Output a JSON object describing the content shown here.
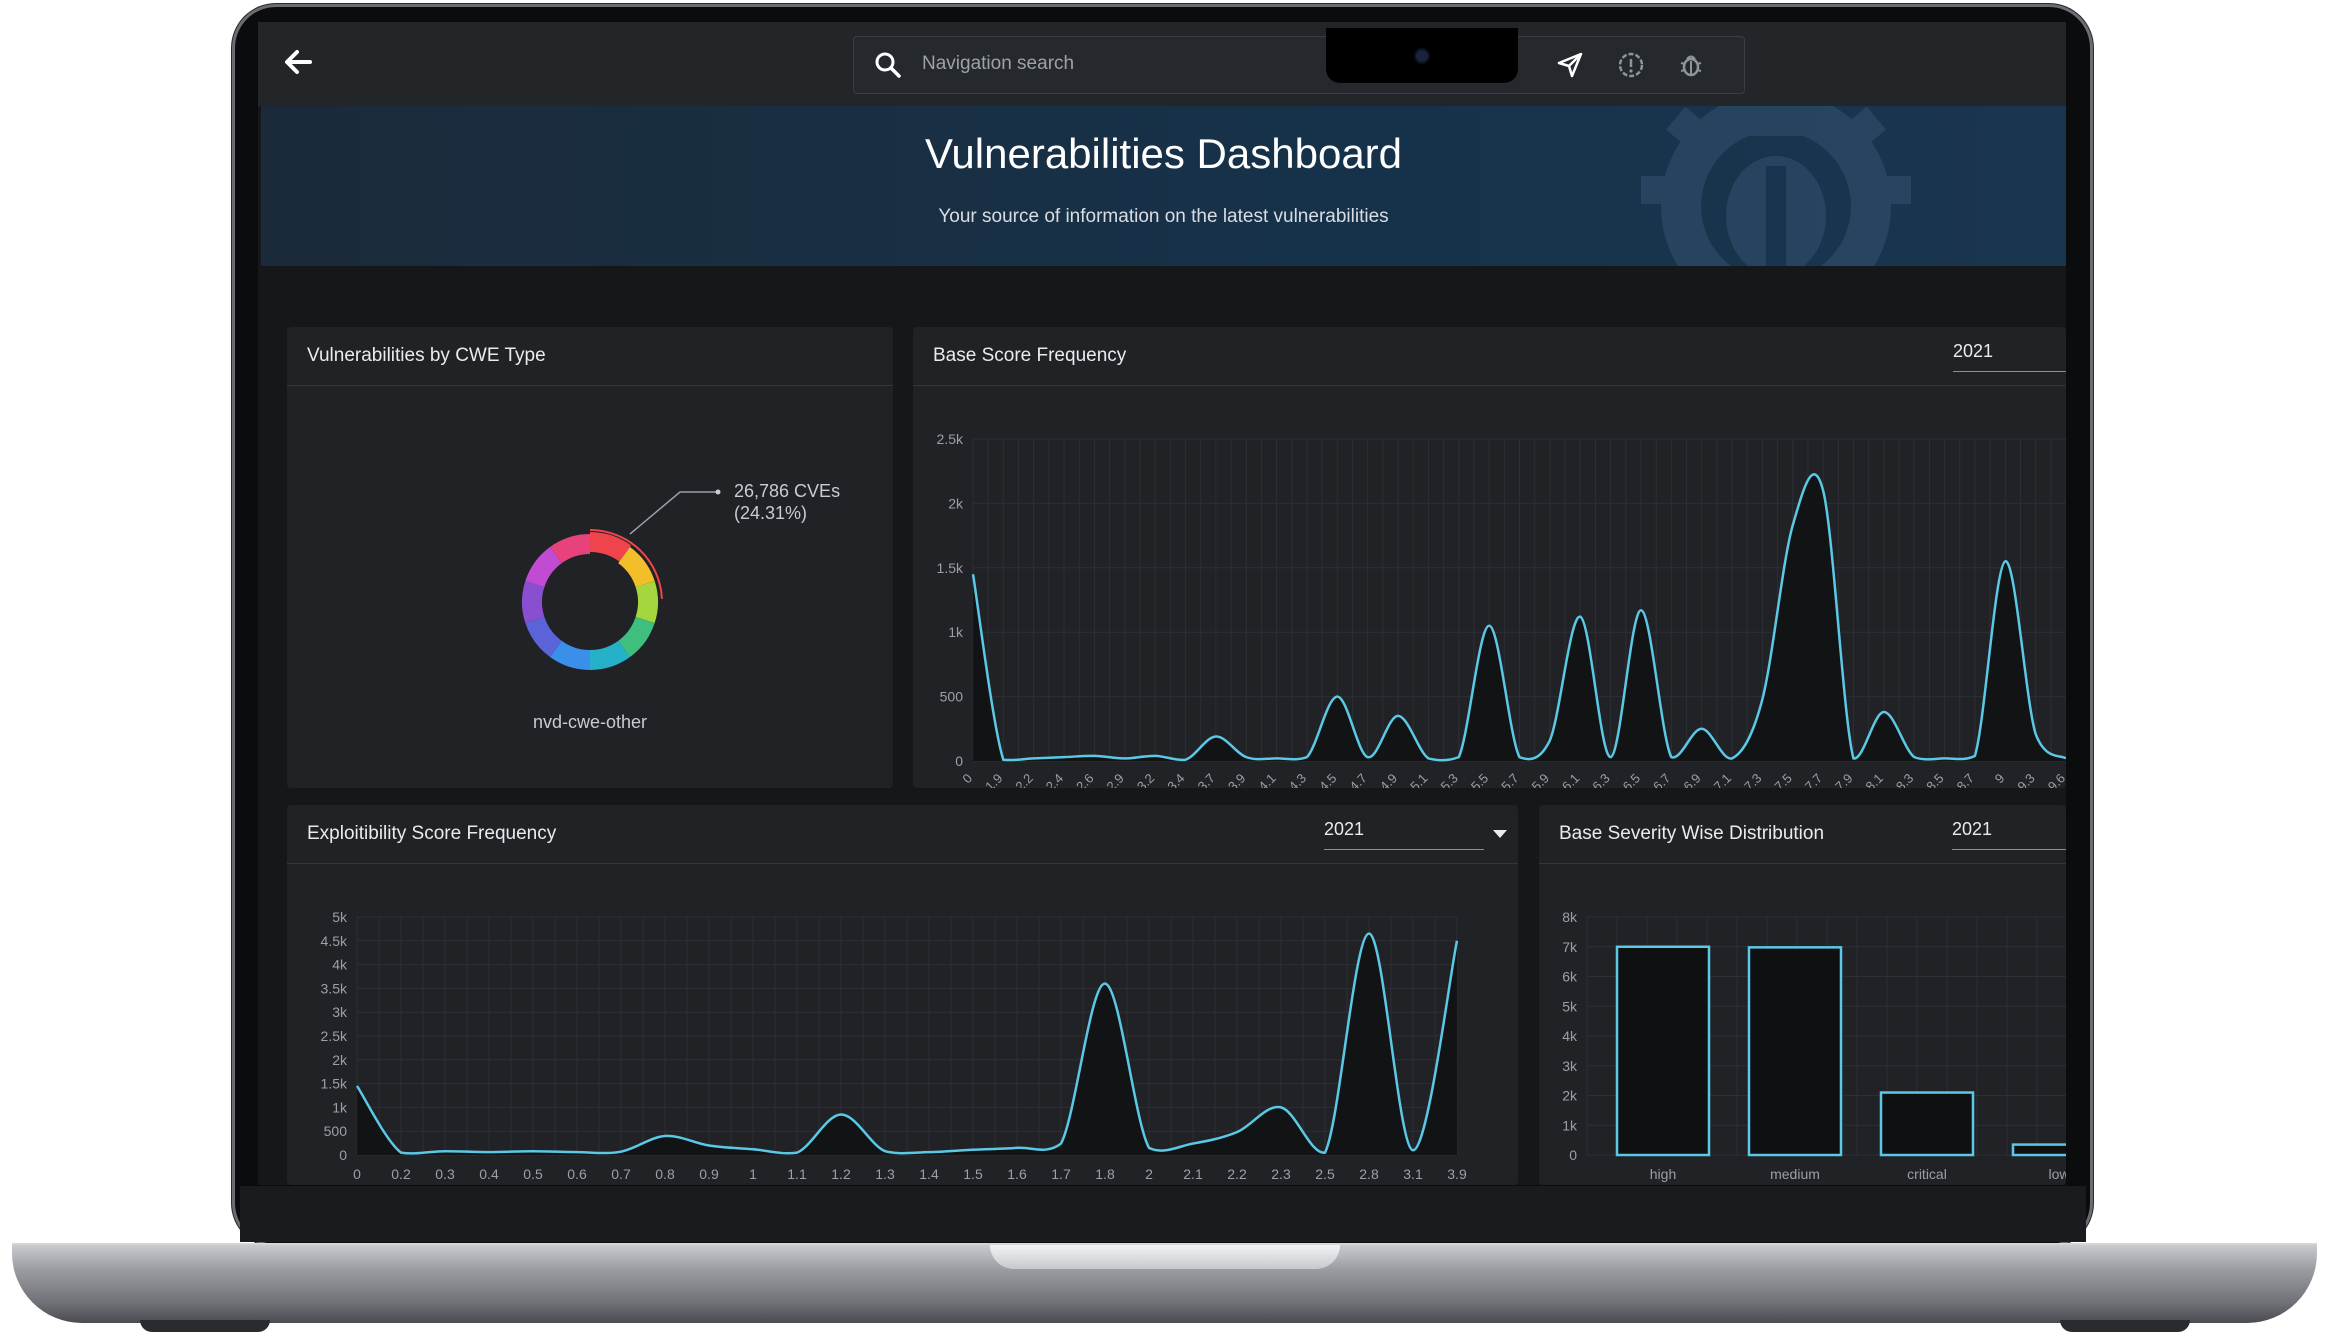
{
  "app": {
    "search_placeholder": "Navigation search",
    "title": "Vulnerabilities Dashboard",
    "subtitle": "Your source of information on the latest vulnerabilities"
  },
  "icons": [
    "back-arrow-icon",
    "search-icon",
    "send-icon",
    "alert-icon",
    "bug-icon",
    "gear-bug-watermark-icon",
    "dropdown-caret-icon"
  ],
  "colors": {
    "line": "#5bc8e6",
    "panel": "#202226",
    "hero": "#16324a",
    "text": "#e9ecef"
  },
  "panels": {
    "cwe": {
      "title": "Vulnerabilities by CWE Type",
      "tooltip_value": "26,786 CVEs",
      "tooltip_pct": "(24.31%)",
      "center_label": "nvd-cwe-other"
    },
    "base_score": {
      "title": "Base Score Frequency",
      "year": "2021"
    },
    "exploitability": {
      "title": "Exploitibility Score Frequency",
      "year": "2021"
    },
    "severity": {
      "title": "Base Severity Wise Distribution",
      "year": "2021"
    }
  },
  "chart_data": [
    {
      "type": "pie",
      "title": "Vulnerabilities by CWE Type",
      "labels": [
        "nvd-cwe-other"
      ],
      "highlight": {
        "label": "nvd-cwe-other",
        "value": 26786,
        "percent": 24.31
      },
      "colors": [
        "#f0444c",
        "#f2bf2a",
        "#a6d63d",
        "#3fbf7e",
        "#25b2c8",
        "#3a8fe8",
        "#5b63d8",
        "#8a4fd1",
        "#c24bd3",
        "#e8427c"
      ]
    },
    {
      "type": "line",
      "title": "Base Score Frequency",
      "x": [
        "0",
        "1.9",
        "2.2",
        "2.4",
        "2.6",
        "2.9",
        "3.2",
        "3.4",
        "3.7",
        "3.9",
        "4.1",
        "4.3",
        "4.5",
        "4.7",
        "4.9",
        "5.1",
        "5.3",
        "5.5",
        "5.7",
        "5.9",
        "6.1",
        "6.3",
        "6.5",
        "6.7",
        "6.9",
        "7.1",
        "7.3",
        "7.5",
        "7.7",
        "7.9",
        "8.1",
        "8.3",
        "8.5",
        "8.7",
        "9",
        "9.3",
        "9.6"
      ],
      "y": [
        1450,
        10,
        20,
        30,
        40,
        20,
        40,
        10,
        190,
        30,
        20,
        30,
        500,
        30,
        350,
        20,
        30,
        1050,
        30,
        160,
        1120,
        30,
        1170,
        30,
        250,
        20,
        480,
        1830,
        2100,
        20,
        380,
        30,
        20,
        40,
        1550,
        210,
        20
      ],
      "ylim": [
        0,
        2500
      ],
      "yticks": [
        "0",
        "500",
        "1k",
        "1.5k",
        "2k",
        "2.5k"
      ]
    },
    {
      "type": "line",
      "title": "Exploitibility Score Frequency",
      "x": [
        "0",
        "0.2",
        "0.3",
        "0.4",
        "0.5",
        "0.6",
        "0.7",
        "0.8",
        "0.9",
        "1",
        "1.1",
        "1.2",
        "1.3",
        "1.4",
        "1.5",
        "1.6",
        "1.7",
        "1.8",
        "2",
        "2.1",
        "2.2",
        "2.3",
        "2.5",
        "2.8",
        "3.1",
        "3.9"
      ],
      "y": [
        1450,
        50,
        80,
        60,
        80,
        60,
        70,
        400,
        200,
        120,
        50,
        850,
        80,
        60,
        110,
        150,
        240,
        3600,
        150,
        240,
        480,
        1000,
        50,
        4650,
        100,
        4500
      ],
      "ylim": [
        0,
        5000
      ],
      "yticks": [
        "0",
        "500",
        "1k",
        "1.5k",
        "2k",
        "2.5k",
        "3k",
        "3.5k",
        "4k",
        "4.5k",
        "5k"
      ]
    },
    {
      "type": "bar",
      "title": "Base Severity Wise Distribution",
      "categories": [
        "high",
        "medium",
        "critical",
        "low"
      ],
      "values": [
        7000,
        6980,
        2100,
        350
      ],
      "ylim": [
        0,
        8000
      ],
      "yticks": [
        "0",
        "1k",
        "2k",
        "3k",
        "4k",
        "5k",
        "6k",
        "7k",
        "8k"
      ]
    }
  ]
}
